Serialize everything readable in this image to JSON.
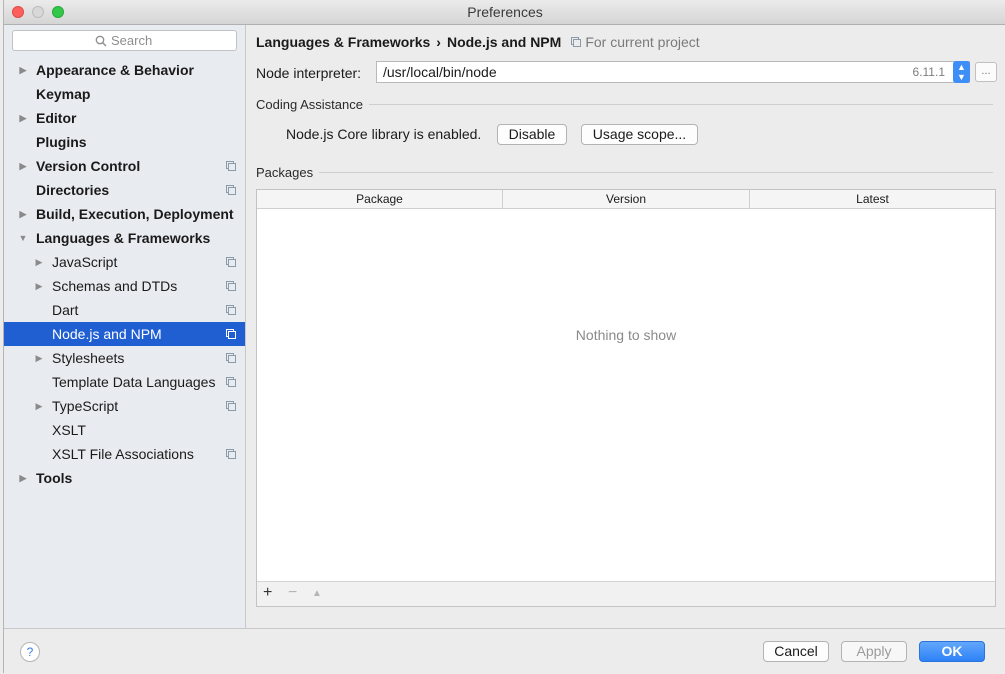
{
  "window": {
    "title": "Preferences"
  },
  "search": {
    "placeholder": "Search"
  },
  "sidebar": {
    "items": [
      {
        "label": "Appearance & Behavior",
        "level": 0,
        "expander": "collapsed",
        "project": false
      },
      {
        "label": "Keymap",
        "level": 0,
        "expander": "none",
        "project": false
      },
      {
        "label": "Editor",
        "level": 0,
        "expander": "collapsed",
        "project": false
      },
      {
        "label": "Plugins",
        "level": 0,
        "expander": "none",
        "project": false
      },
      {
        "label": "Version Control",
        "level": 0,
        "expander": "collapsed",
        "project": true
      },
      {
        "label": "Directories",
        "level": 0,
        "expander": "none",
        "project": true
      },
      {
        "label": "Build, Execution, Deployment",
        "level": 0,
        "expander": "collapsed",
        "project": false
      },
      {
        "label": "Languages & Frameworks",
        "level": 0,
        "expander": "expanded",
        "project": false
      },
      {
        "label": "JavaScript",
        "level": 1,
        "expander": "collapsed",
        "project": true
      },
      {
        "label": "Schemas and DTDs",
        "level": 1,
        "expander": "collapsed",
        "project": true
      },
      {
        "label": "Dart",
        "level": 1,
        "expander": "none",
        "project": true
      },
      {
        "label": "Node.js and NPM",
        "level": 1,
        "expander": "none",
        "project": true,
        "selected": true
      },
      {
        "label": "Stylesheets",
        "level": 1,
        "expander": "collapsed",
        "project": true
      },
      {
        "label": "Template Data Languages",
        "level": 1,
        "expander": "none",
        "project": true
      },
      {
        "label": "TypeScript",
        "level": 1,
        "expander": "collapsed",
        "project": true
      },
      {
        "label": "XSLT",
        "level": 1,
        "expander": "none",
        "project": false
      },
      {
        "label": "XSLT File Associations",
        "level": 1,
        "expander": "none",
        "project": true
      },
      {
        "label": "Tools",
        "level": 0,
        "expander": "collapsed",
        "project": false
      }
    ]
  },
  "main": {
    "breadcrumb": {
      "parent": "Languages & Frameworks",
      "separator": "›",
      "current": "Node.js and NPM",
      "scope": "For current project"
    },
    "interpreter": {
      "label": "Node interpreter:",
      "value": "/usr/local/bin/node",
      "version": "6.11.1",
      "browse_label": "..."
    },
    "coding_assistance": {
      "title": "Coding Assistance",
      "status": "Node.js Core library is enabled.",
      "disable_label": "Disable",
      "scope_label": "Usage scope..."
    },
    "packages": {
      "title": "Packages",
      "columns": [
        "Package",
        "Version",
        "Latest"
      ],
      "rows": [],
      "empty_text": "Nothing to show",
      "toolbar": {
        "add": "+",
        "remove": "−",
        "upgrade": "▲"
      }
    }
  },
  "footer": {
    "help": "?",
    "cancel": "Cancel",
    "apply": "Apply",
    "ok": "OK"
  },
  "colors": {
    "selection": "#1f5fd2",
    "primary_button": "#2e82f6"
  }
}
